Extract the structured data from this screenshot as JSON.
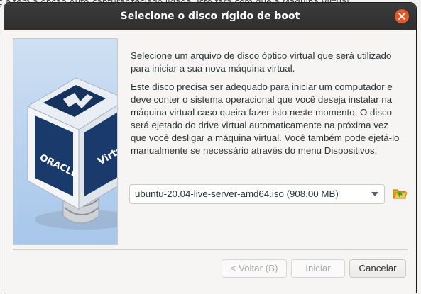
{
  "background_window": {
    "text": "ç e tem a opção Auto-capturar teclado ligada. Isto fará com que a Máquina Virtual"
  },
  "dialog": {
    "title": "Selecione o disco rígido de boot",
    "description_1": "Selecione um arquivo de disco óptico virtual que será utilizado para iniciar a sua nova máquina virtual.",
    "description_2": "Este disco precisa ser adequado para iniciar um computador e deve conter o sistema operacional que você deseja instalar na máquina virtual caso queira fazer isto neste momento. O disco será ejetado do drive virtual automaticamente na próxima vez que você desligar a máquina virtual. Você também pode ejetá-lo manualmente se necessário através do menu Dispositivos.",
    "disk_select": {
      "selected": "ubuntu-20.04-live-server-amd64.iso (908,00 MB)"
    },
    "buttons": {
      "back": "< Voltar (B)",
      "start": "Iniciar",
      "cancel": "Cancelar"
    },
    "illustration": {
      "cube_text_front": "ORACLE",
      "cube_text_side": "Virtu"
    }
  },
  "colors": {
    "titlebar": "#2f2f2f",
    "close_button": "#e05a2b",
    "folder_icon": "#f0b429",
    "folder_arrow": "#3aa63a"
  },
  "icons": {
    "close": "close-icon",
    "dropdown": "chevron-down-icon",
    "folder": "folder-open-icon"
  }
}
